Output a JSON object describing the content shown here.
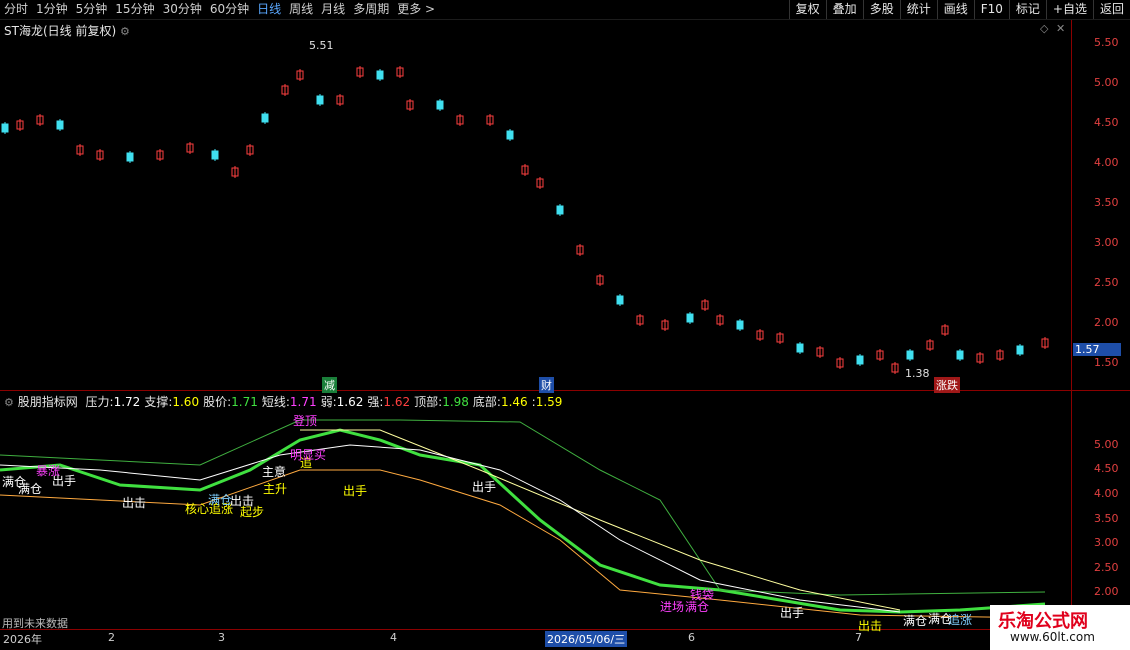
{
  "toolbar": {
    "periods": [
      "分时",
      "1分钟",
      "5分钟",
      "15分钟",
      "30分钟",
      "60分钟",
      "日线",
      "周线",
      "月线",
      "多周期",
      "更多 >"
    ],
    "active_period": "日线",
    "actions": [
      "复权",
      "叠加",
      "多股",
      "统计",
      "画线",
      "F10",
      "标记",
      "+自选",
      "返回"
    ]
  },
  "price_panel": {
    "title": "ST海龙(日线 前复权)",
    "high_label": "5.51",
    "low_label": "1.38",
    "last_price": "1.57",
    "markers": {
      "jian": "减",
      "cai": "财",
      "zhangdie": "涨跌"
    },
    "y_ticks": [
      "5.50",
      "5.00",
      "4.50",
      "4.00",
      "3.50",
      "3.00",
      "2.50",
      "2.00",
      "1.50"
    ]
  },
  "indicator_panel": {
    "name": "股朋指标网",
    "legend": [
      {
        "k": "压力:",
        "v": "1.72",
        "c": "#ffffff"
      },
      {
        "k": "支撑:",
        "v": "1.60",
        "c": "#ffff00"
      },
      {
        "k": "股价:",
        "v": "1.71",
        "c": "#40e040"
      },
      {
        "k": "短线:",
        "v": "1.71",
        "c": "#ff40ff"
      },
      {
        "k": "弱:",
        "v": "1.62",
        "c": "#ffffff"
      },
      {
        "k": "强:",
        "v": "1.62",
        "c": "#ff4040"
      },
      {
        "k": "顶部:",
        "v": "1.98",
        "c": "#40e040"
      },
      {
        "k": "底部:",
        "v": "1.46",
        "c": "#ffff00"
      },
      {
        "k": ":",
        "v": "1.59",
        "c": "#ffff00"
      }
    ],
    "y_ticks": [
      "5.00",
      "4.50",
      "4.00",
      "3.50",
      "3.00",
      "2.50",
      "2.00"
    ],
    "annotations": [
      "满仓",
      "满仓",
      "出手",
      "出击",
      "核心追涨",
      "满仓",
      "出击",
      "起步",
      "追",
      "出手",
      "出手",
      "满仓",
      "进场",
      "出手",
      "出击",
      "满仓",
      "追涨",
      "钱袋",
      "明显买",
      "登顶",
      "主意",
      "主升",
      "暴涨",
      "满仓"
    ],
    "note": "用到未来数据"
  },
  "date_axis": [
    "2026年",
    "2",
    "3",
    "4",
    "2026/05/06/三",
    "6",
    "7"
  ],
  "watermark": {
    "title": "乐淘公式网",
    "url": "www.60lt.com"
  }
}
